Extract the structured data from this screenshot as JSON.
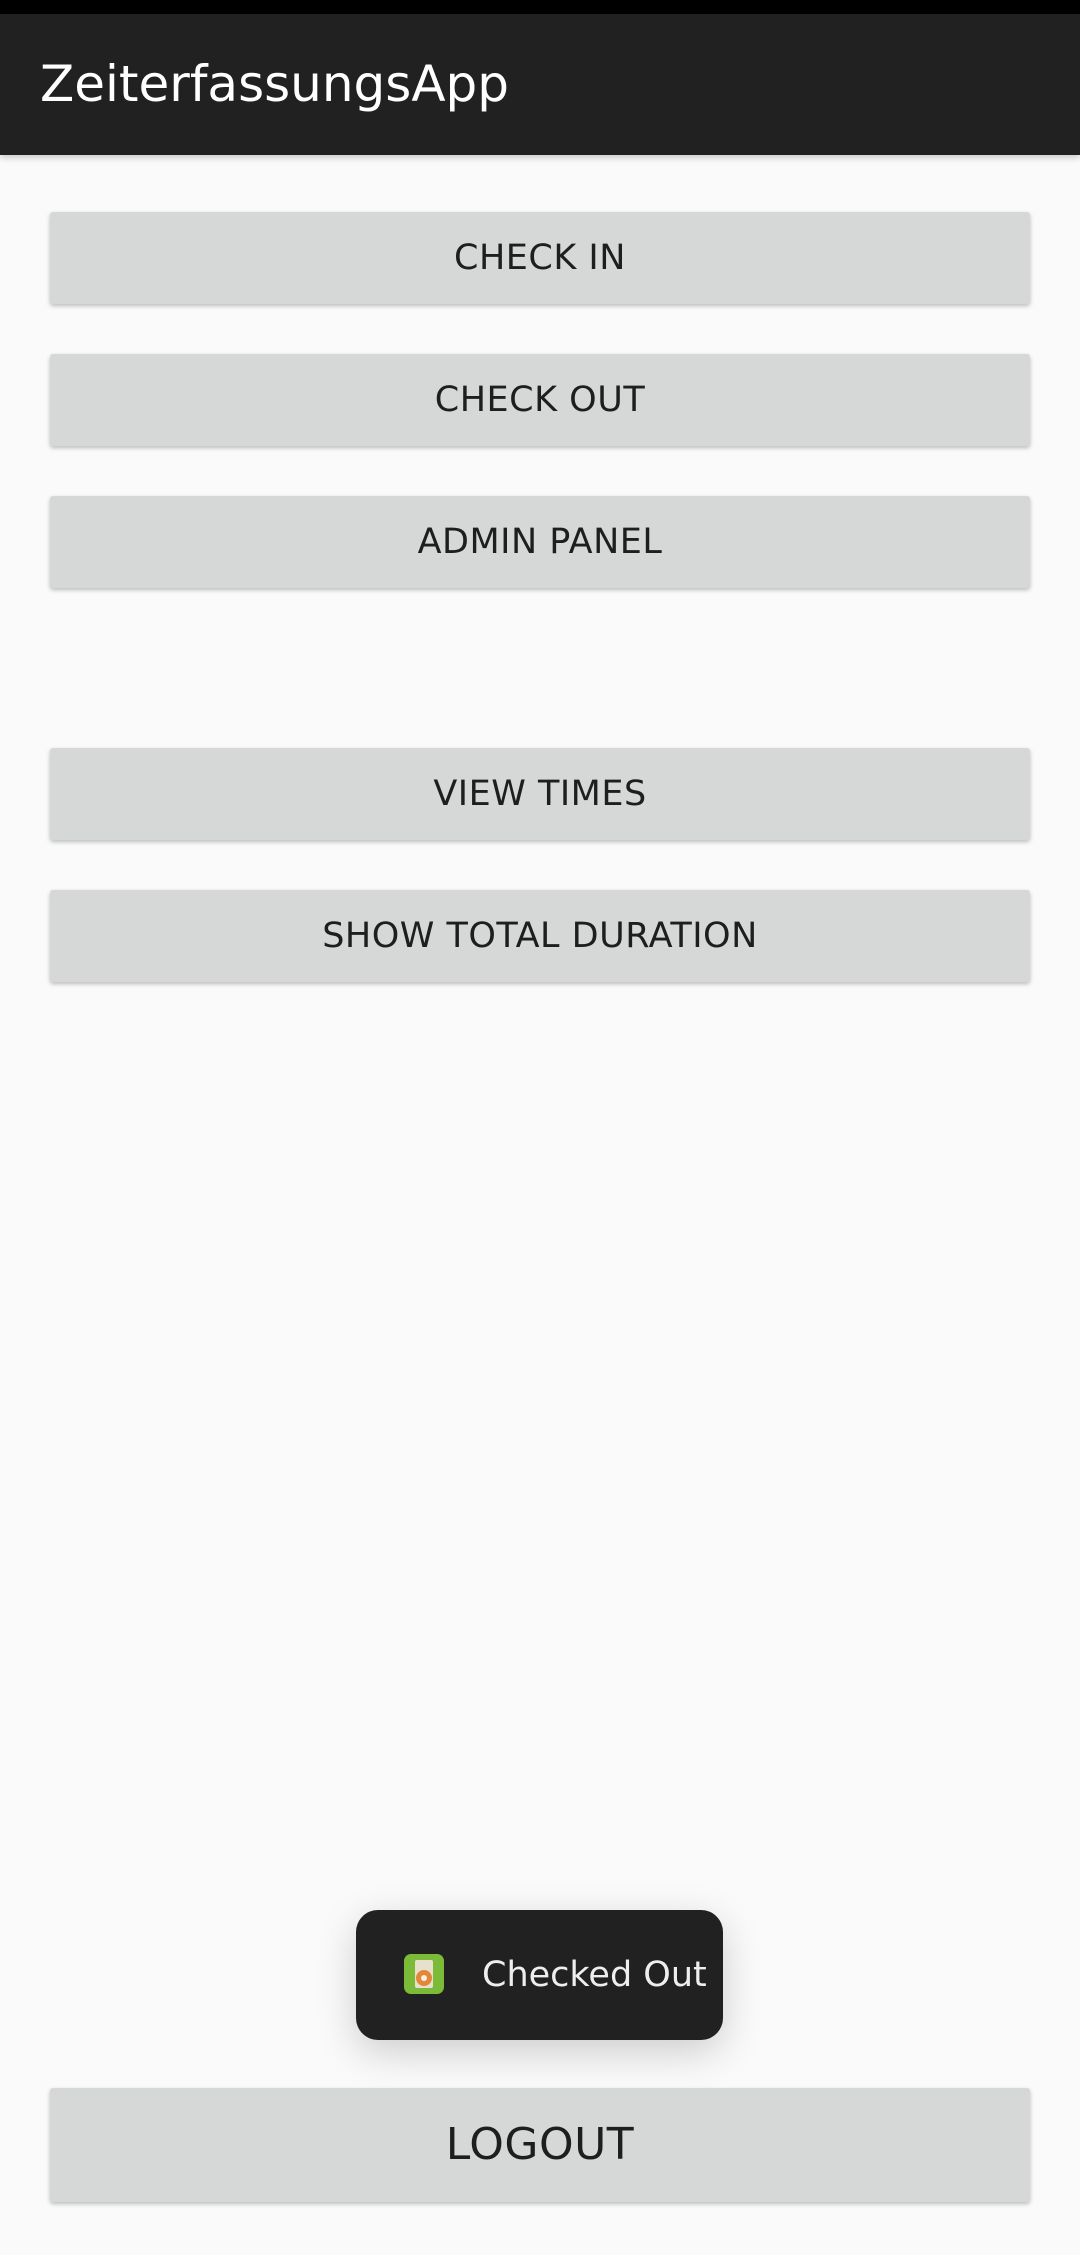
{
  "app_bar": {
    "title": "ZeiterfassungsApp",
    "background": "#212121"
  },
  "buttons": {
    "check_in": "CHECK IN",
    "check_out": "CHECK OUT",
    "admin_panel": "ADMIN PANEL",
    "view_times": "VIEW TIMES",
    "show_total_duration": "SHOW TOTAL DURATION",
    "logout": "LOGOUT"
  },
  "toast": {
    "icon": "app-clipboard-clock-icon",
    "text": "Checked Out"
  },
  "colors": {
    "page_background": "#fafafa",
    "button_background": "#d6d7d7",
    "button_text": "#1e1e1e",
    "toast_background": "#212121",
    "icon_green": "#7cbb37"
  }
}
